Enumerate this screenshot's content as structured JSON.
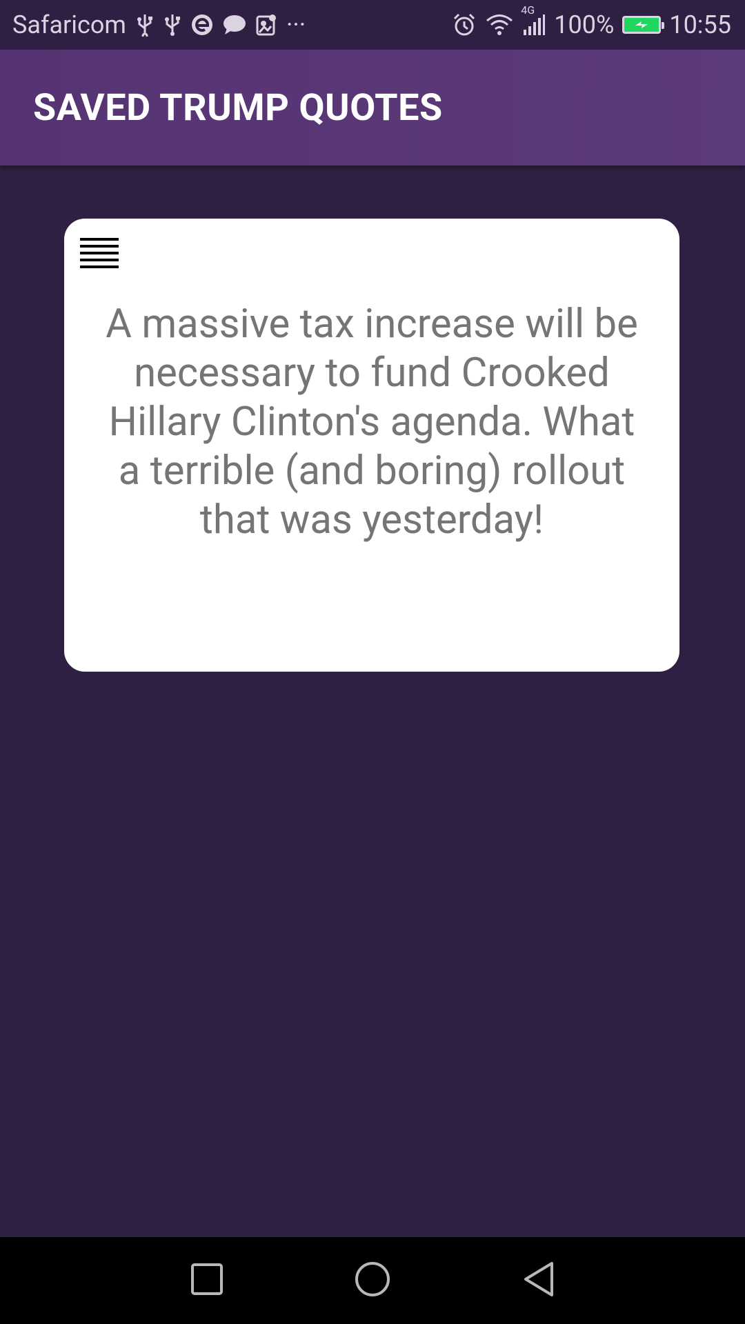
{
  "status_bar": {
    "carrier": "Safaricom",
    "left_icons": [
      "usb-icon",
      "usb-icon",
      "browser-icon",
      "chat-icon",
      "gallery-icon",
      "more-icon"
    ],
    "more": "···",
    "right_icons": [
      "alarm-icon",
      "wifi-icon",
      "signal-icon",
      "battery-icon"
    ],
    "network_type": "4G",
    "battery_percent": "100%",
    "time": "10:55",
    "battery_color": "#1fd65f"
  },
  "app_bar": {
    "title": "SAVED TRUMP QUOTES",
    "color": "#5a377a"
  },
  "quote_card": {
    "menu_icon": "hamburger-menu-icon",
    "text": "A massive tax increase will be necessary to fund Crooked Hillary Clinton's agenda. What a terrible (and boring) rollout that was yesterday!"
  },
  "nav_bar": {
    "buttons": [
      "recents-square-icon",
      "home-circle-icon",
      "back-triangle-icon"
    ]
  },
  "colors": {
    "background": "#2f2043",
    "card": "#ffffff",
    "quote_text": "#757575"
  }
}
